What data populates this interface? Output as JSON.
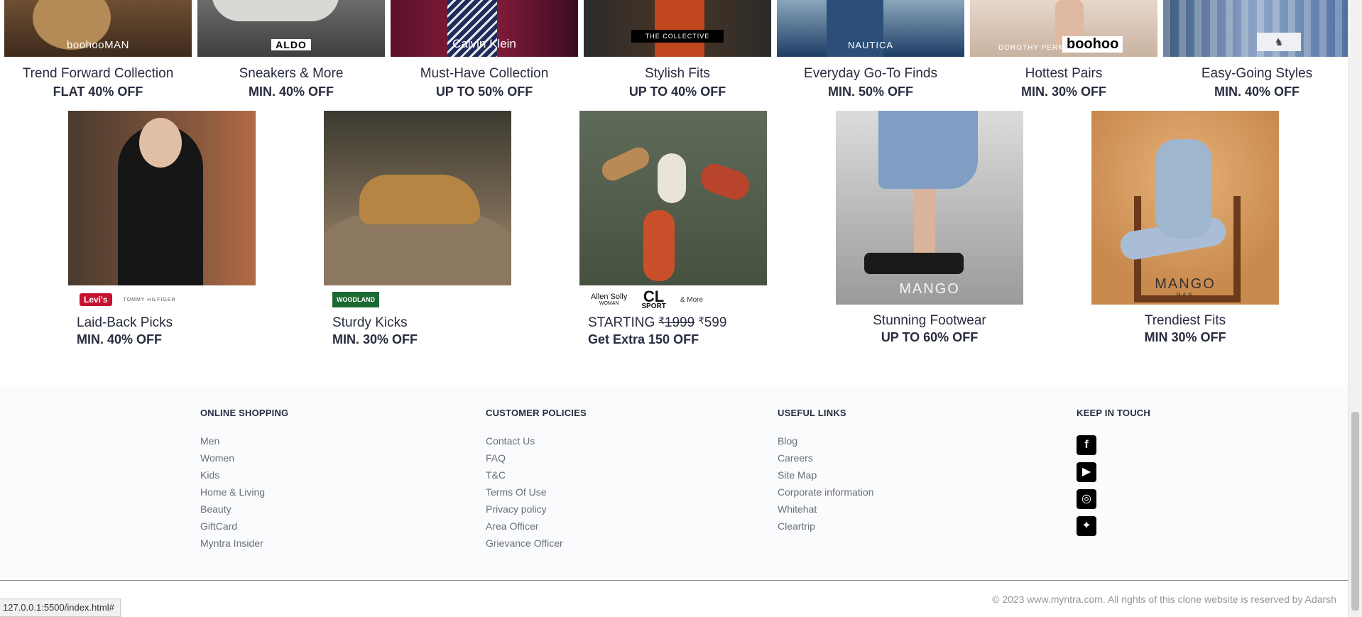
{
  "top_cards": [
    {
      "brand": "boohooMAN",
      "title": "Trend Forward Collection",
      "offer": "FLAT 40% OFF"
    },
    {
      "brand": "ALDO",
      "title": "Sneakers & More",
      "offer": "MIN. 40% OFF"
    },
    {
      "brand": "Calvin Klein",
      "title": "Must-Have Collection",
      "offer": "UP TO 50% OFF"
    },
    {
      "brand": "THE COLLECTIVE",
      "title": "Stylish Fits",
      "offer": "UP TO 40% OFF"
    },
    {
      "brand": "NAUTICA",
      "title": "Everyday Go-To Finds",
      "offer": "MIN. 50% OFF"
    },
    {
      "brand": "DOROTHY PERKINS",
      "brand2": "boohoo",
      "title": "Hottest Pairs",
      "offer": "MIN. 30% OFF"
    },
    {
      "brand": "♞",
      "title": "Easy-Going Styles",
      "offer": "MIN. 40% OFF"
    }
  ],
  "cards": [
    {
      "logo1": "Levi's",
      "logo2": "TOMMY HILFIGER",
      "title": "Laid-Back Picks",
      "offer": "MIN. 40% OFF"
    },
    {
      "logo1": "WOODLAND",
      "title": "Sturdy Kicks",
      "offer": "MIN. 30% OFF"
    },
    {
      "logo1": "Allen Solly",
      "logo1_sub": "WOMAN",
      "logo2": "CL",
      "logo2_sub": "SPORT",
      "logo3": "& More",
      "title_prefix": "STARTING",
      "price_old": "1999",
      "price_new": "599",
      "currency": "₹",
      "offer": "Get Extra 150 OFF"
    },
    {
      "brand": "MANGO",
      "title": "Stunning Footwear",
      "offer": "UP TO 60% OFF"
    },
    {
      "brand": "MANGO",
      "brand_sub": "MAN",
      "title": "Trendiest Fits",
      "offer": "MIN 30% OFF"
    }
  ],
  "footer": {
    "online_shopping": {
      "heading": "ONLINE SHOPPING",
      "links": [
        "Men",
        "Women",
        "Kids",
        "Home & Living",
        "Beauty",
        "GiftCard",
        "Myntra Insider"
      ]
    },
    "customer_policies": {
      "heading": "CUSTOMER POLICIES",
      "links": [
        "Contact Us",
        "FAQ",
        "T&C",
        "Terms Of Use",
        "Privacy policy",
        "Area Officer",
        "Grievance Officer"
      ]
    },
    "useful_links": {
      "heading": "USEFUL LINKS",
      "links": [
        "Blog",
        "Careers",
        "Site Map",
        "Corporate information",
        "Whitehat",
        "Cleartrip"
      ]
    },
    "keep_in_touch": {
      "heading": "KEEP IN TOUCH",
      "icons": [
        "facebook-icon",
        "youtube-icon",
        "instagram-icon",
        "twitter-icon"
      ]
    },
    "copyright": "© 2023 www.myntra.com. All rights of this clone website is reserved by Adarsh"
  },
  "status_url": "127.0.0.1:5500/index.html#"
}
